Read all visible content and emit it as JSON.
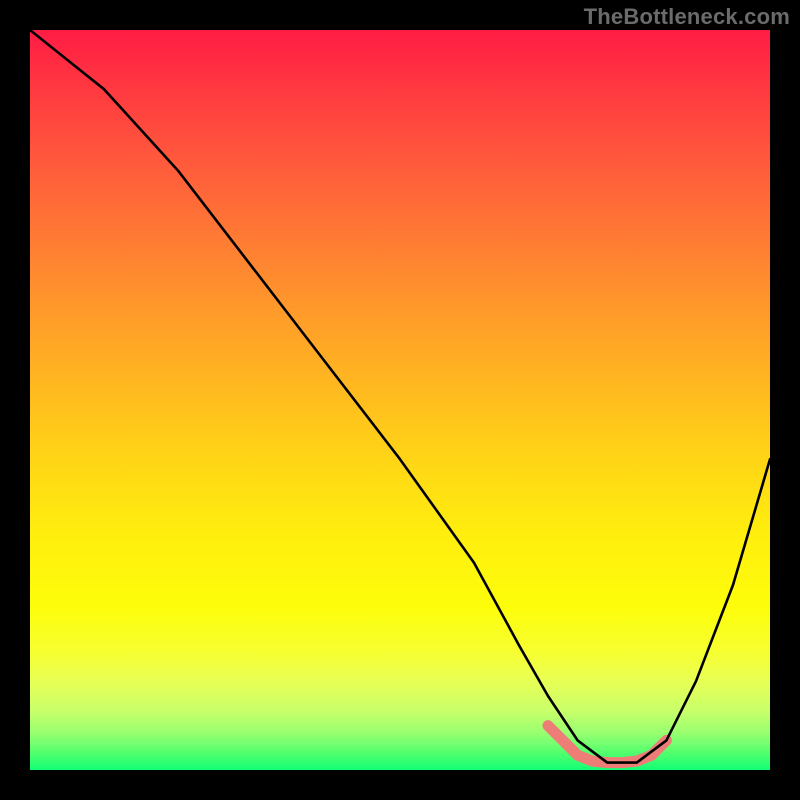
{
  "watermark": "TheBottleneck.com",
  "chart_data": {
    "type": "line",
    "title": "",
    "xlabel": "",
    "ylabel": "",
    "xlim": [
      0,
      100
    ],
    "ylim": [
      0,
      100
    ],
    "grid": false,
    "legend": false,
    "background_gradient_top": "#ff1c44",
    "background_gradient_bottom": "#13ff74",
    "series": [
      {
        "name": "bottleneck-curve",
        "color": "#000000",
        "x": [
          0,
          5,
          10,
          20,
          30,
          40,
          50,
          60,
          66,
          70,
          74,
          78,
          82,
          86,
          90,
          95,
          100
        ],
        "y": [
          100,
          96,
          92,
          81,
          68,
          55,
          42,
          28,
          17,
          10,
          4,
          1,
          1,
          4,
          12,
          25,
          42
        ]
      }
    ],
    "trough_highlight": {
      "color": "#ee7d78",
      "x": [
        70,
        72,
        74,
        76,
        78,
        80,
        82,
        84,
        86
      ],
      "y": [
        6,
        4,
        2,
        1.2,
        1,
        1,
        1.2,
        2,
        4
      ]
    }
  }
}
